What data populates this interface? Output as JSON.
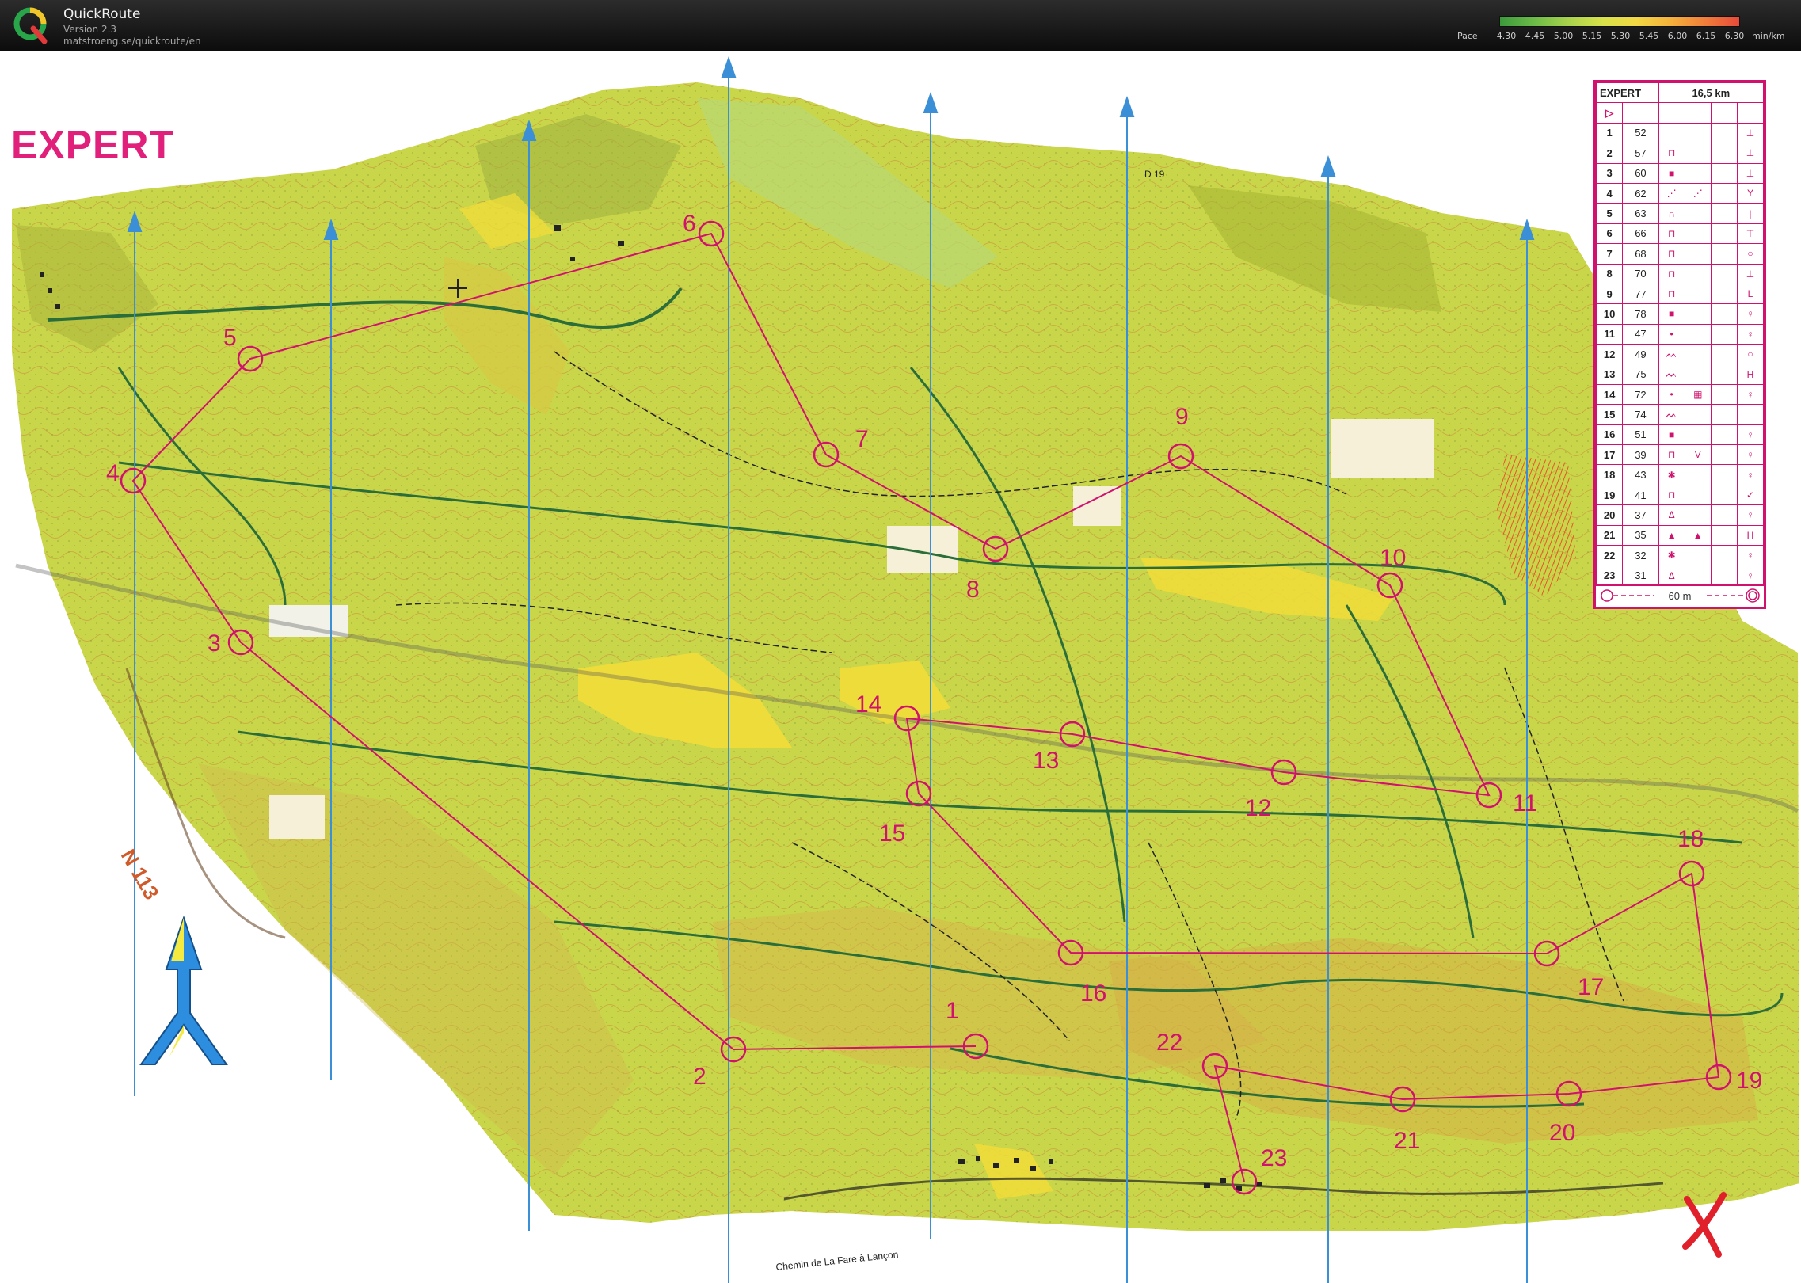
{
  "app": {
    "title": "QuickRoute",
    "version": "Version 2.3",
    "url": "matstroeng.se/quickroute/en",
    "logo_letter": "Q"
  },
  "pace_legend": {
    "label": "Pace",
    "unit": "min/km",
    "ticks": [
      "4.30",
      "4.45",
      "5.00",
      "5.15",
      "5.30",
      "5.45",
      "6.00",
      "6.15",
      "6.30"
    ],
    "colors": [
      "#3c9a3c",
      "#6cbb48",
      "#a8d24c",
      "#d8e24a",
      "#f2d844",
      "#f4b13c",
      "#f07e3a",
      "#e84a3a"
    ]
  },
  "map": {
    "course_title": "EXPERT",
    "road_labels": {
      "n113": "N 113",
      "d19": "D 19",
      "chemin": "Chemin de La Fare à Lançon"
    },
    "controls": [
      {
        "label": "1"
      },
      {
        "label": "2"
      },
      {
        "label": "3"
      },
      {
        "label": "4"
      },
      {
        "label": "5"
      },
      {
        "label": "6"
      },
      {
        "label": "7"
      },
      {
        "label": "8"
      },
      {
        "label": "9"
      },
      {
        "label": "10"
      },
      {
        "label": "11"
      },
      {
        "label": "12"
      },
      {
        "label": "13"
      },
      {
        "label": "14"
      },
      {
        "label": "15"
      },
      {
        "label": "16"
      },
      {
        "label": "17"
      },
      {
        "label": "18"
      },
      {
        "label": "19"
      },
      {
        "label": "20"
      },
      {
        "label": "21"
      },
      {
        "label": "22"
      },
      {
        "label": "23"
      }
    ],
    "colors": {
      "course": "#d0126e",
      "meridian": "#3b8fd6",
      "map_base": "#cad64a",
      "open_land": "#eedc3a",
      "route": "#2c6e3a"
    }
  },
  "description_sheet": {
    "course": "EXPERT",
    "length": "16,5 km",
    "start_symbol": "▷",
    "footer": "60 m",
    "rows": [
      {
        "n": "1",
        "code": "52",
        "a": "",
        "b": "",
        "c": "⊥"
      },
      {
        "n": "2",
        "code": "57",
        "a": "⊓",
        "b": "",
        "c": "⊥"
      },
      {
        "n": "3",
        "code": "60",
        "a": "■",
        "b": "",
        "c": "⊥"
      },
      {
        "n": "4",
        "code": "62",
        "a": "⋰",
        "b": "⋰",
        "c": "Y"
      },
      {
        "n": "5",
        "code": "63",
        "a": "∩",
        "b": "",
        "c": "|"
      },
      {
        "n": "6",
        "code": "66",
        "a": "⊓",
        "b": "",
        "c": "⊤"
      },
      {
        "n": "7",
        "code": "68",
        "a": "⊓",
        "b": "",
        "c": "○"
      },
      {
        "n": "8",
        "code": "70",
        "a": "⊓",
        "b": "",
        "c": "⊥"
      },
      {
        "n": "9",
        "code": "77",
        "a": "⊓",
        "b": "",
        "c": "L"
      },
      {
        "n": "10",
        "code": "78",
        "a": "■",
        "b": "",
        "c": "♀"
      },
      {
        "n": "11",
        "code": "47",
        "a": "•",
        "b": "",
        "c": "♀"
      },
      {
        "n": "12",
        "code": "49",
        "a": "ᨓ",
        "b": "",
        "c": "○"
      },
      {
        "n": "13",
        "code": "75",
        "a": "ᨓ",
        "b": "",
        "c": "H"
      },
      {
        "n": "14",
        "code": "72",
        "a": "•",
        "b": "▦",
        "c": "♀"
      },
      {
        "n": "15",
        "code": "74",
        "a": "ᨓ",
        "b": "",
        "c": ""
      },
      {
        "n": "16",
        "code": "51",
        "a": "■",
        "b": "",
        "c": "♀"
      },
      {
        "n": "17",
        "code": "39",
        "a": "⊓",
        "b": "V",
        "c": "♀"
      },
      {
        "n": "18",
        "code": "43",
        "a": "✱",
        "b": "",
        "c": "♀"
      },
      {
        "n": "19",
        "code": "41",
        "a": "⊓",
        "b": "",
        "c": "✓"
      },
      {
        "n": "20",
        "code": "37",
        "a": "Δ",
        "b": "",
        "c": "♀"
      },
      {
        "n": "21",
        "code": "35",
        "a": "▲",
        "b": "▲",
        "c": "H"
      },
      {
        "n": "22",
        "code": "32",
        "a": "✱",
        "b": "",
        "c": "♀"
      },
      {
        "n": "23",
        "code": "31",
        "a": "Δ",
        "b": "",
        "c": "♀"
      }
    ]
  }
}
